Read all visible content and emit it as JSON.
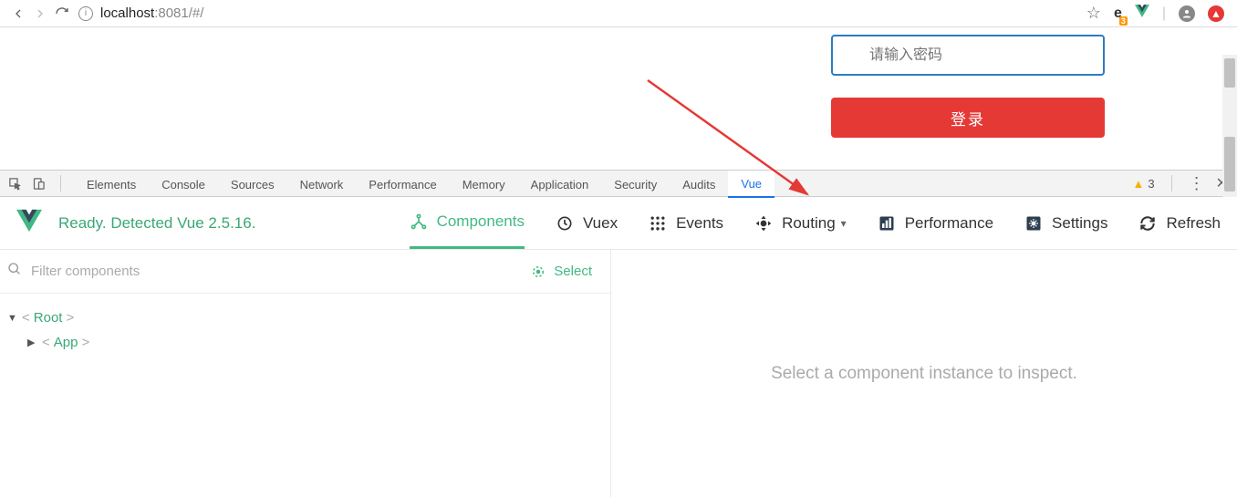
{
  "browser": {
    "url_host": "localhost",
    "url_port": ":8081",
    "url_hash": "/#/",
    "e_badge": "e",
    "e_badge_count": "3"
  },
  "page": {
    "password_placeholder": "请输入密码",
    "login_label": "登录"
  },
  "devtools": {
    "tabs": [
      "Elements",
      "Console",
      "Sources",
      "Network",
      "Performance",
      "Memory",
      "Application",
      "Security",
      "Audits",
      "Vue"
    ],
    "active_tab": "Vue",
    "warning_count": "3"
  },
  "vue": {
    "status": "Ready. Detected Vue 2.5.16.",
    "tabs": {
      "components": "Components",
      "vuex": "Vuex",
      "events": "Events",
      "routing": "Routing",
      "performance": "Performance",
      "settings": "Settings",
      "refresh": "Refresh"
    },
    "filter_placeholder": "Filter components",
    "select_label": "Select",
    "tree": {
      "root": "Root",
      "app": "App"
    },
    "inspect_placeholder": "Select a component instance to inspect."
  }
}
